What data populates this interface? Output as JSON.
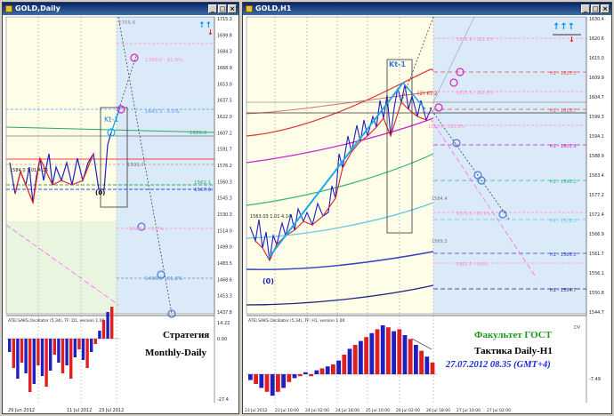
{
  "windows": {
    "daily": {
      "title": "GOLD,Daily",
      "price_labels": [
        "1715.3",
        "1699.8",
        "1684.3",
        "1668.9",
        "1653.0",
        "1637.5",
        "1622.0",
        "1607.2",
        "1591.7",
        "1576.2",
        "1560.3",
        "1545.3",
        "1530.3",
        "1514.0",
        "1499.0",
        "1483.5",
        "1468.6",
        "1453.3",
        "1437.8"
      ],
      "xlabels": [
        "29 Jun 2012",
        "11 Jul 2012",
        "23 Jul 2012"
      ],
      "osc_title": "ATEI.SAKS.Oscillator (5,34), TF: D1, version 1.00",
      "osc_labels": [
        "14.22",
        "0.00",
        "-27.4"
      ],
      "strategy_line1": "Стратегия",
      "strategy_line2": "Monthly-Daily",
      "kt_label": "Kt-1",
      "zero_label": "(0)",
      "annotations": [
        "1643.3 - 0.0%",
        "1626.0",
        "1591.7",
        "1562.1",
        "1567.6",
        "1520.3 - 0.0%",
        "1496.6 - 61.8%",
        "1709.0 - 61.8%",
        "1705.6"
      ],
      "start_label": "1584.0 1.01 4.14"
    },
    "h1": {
      "title": "GOLD,H1",
      "price_labels": [
        "1630.4",
        "1620.6",
        "1615.0",
        "1609.9",
        "1604.7",
        "1599.3",
        "1594.1",
        "1588.9",
        "1583.4",
        "1577.2",
        "1572.4",
        "1566.9",
        "1561.7",
        "1556.1",
        "1550.8",
        "1544.7"
      ],
      "xlabels": [
        "23 Jul 2012",
        "23 Jul 10:00",
        "24 Jul 02:00",
        "24 Jul 18:00",
        "25 Jul 10:00",
        "26 Jul 02:00",
        "26 Jul 18:00",
        "27 Jul 10:00",
        "27 Jul 02:00"
      ],
      "osc_title": "ATEI.SAKS.Oscillator (5,34), TF: H1, version 1.00",
      "osc_labels": [
        "DV",
        "-7.49"
      ],
      "faculty": "Факультет ГОСТ",
      "tactic": "Тактика Daily-H1",
      "datetime": "27.07.2012  08.35 (GMT+4)",
      "kt_label": "Kt-1",
      "kt2_label": "(2) Kt-2",
      "zero_label": "(0)",
      "levels": [
        "1628.9 - 161.8%",
        "1625.5 - 161.8%",
        "H1 - 1625.5",
        "H1 - 1613.7",
        "H1 - 1601.9",
        "H1 - 1590.1",
        "H1 - 1578.3",
        "H1 - 1566.5",
        "H1 - 1554.7",
        "1612.9 - 161.8%",
        "1611.1 - 161.8%",
        "1601.8 - 61.8%",
        "1577.8 - 0.0%",
        "1571.3 - 61.8%",
        "1562.5 - 0.0%",
        "1584.4",
        "1569.3"
      ],
      "start_label": "1563.03 1.01 4.14"
    }
  },
  "colors": {
    "title_bg": "#0a246a",
    "up_arrow": "#0090ff",
    "down_arrow": "#ff0000",
    "faculty": "#1a9a1a",
    "tactic": "#000000",
    "datetime": "#1a2ad8"
  },
  "icons": [
    "up-arrow-icon",
    "down-arrow-icon",
    "window-icon",
    "minimize-icon",
    "maximize-icon",
    "close-icon"
  ]
}
